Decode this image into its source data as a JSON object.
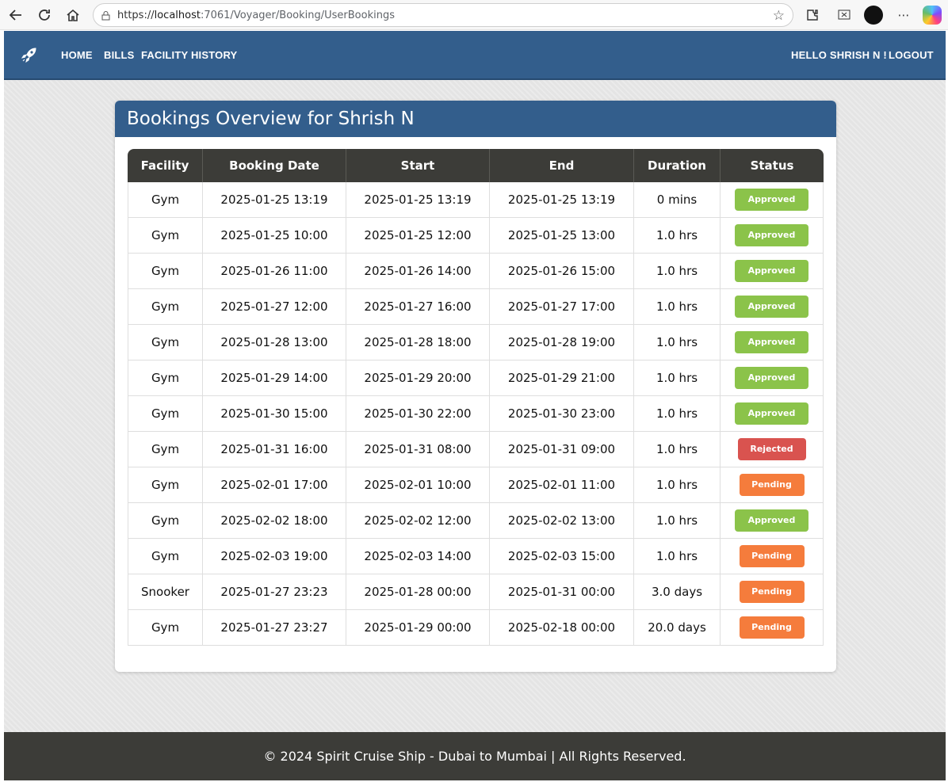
{
  "browser": {
    "url_prefix": "https://",
    "url_host": "localhost",
    "url_rest": ":7061/Voyager/Booking/UserBookings"
  },
  "navbar": {
    "links": [
      "HOME",
      "BILLS",
      "FACILITY HISTORY"
    ],
    "greeting": "HELLO SHRISH N !",
    "logout": "LOGOUT"
  },
  "card": {
    "title": "Bookings Overview for Shrish N"
  },
  "table": {
    "headers": [
      "Facility",
      "Booking Date",
      "Start",
      "End",
      "Duration",
      "Status"
    ],
    "rows": [
      [
        "Gym",
        "2025-01-25 13:19",
        "2025-01-25 13:19",
        "2025-01-25 13:19",
        "0 mins",
        "Approved"
      ],
      [
        "Gym",
        "2025-01-25 10:00",
        "2025-01-25 12:00",
        "2025-01-25 13:00",
        "1.0 hrs",
        "Approved"
      ],
      [
        "Gym",
        "2025-01-26 11:00",
        "2025-01-26 14:00",
        "2025-01-26 15:00",
        "1.0 hrs",
        "Approved"
      ],
      [
        "Gym",
        "2025-01-27 12:00",
        "2025-01-27 16:00",
        "2025-01-27 17:00",
        "1.0 hrs",
        "Approved"
      ],
      [
        "Gym",
        "2025-01-28 13:00",
        "2025-01-28 18:00",
        "2025-01-28 19:00",
        "1.0 hrs",
        "Approved"
      ],
      [
        "Gym",
        "2025-01-29 14:00",
        "2025-01-29 20:00",
        "2025-01-29 21:00",
        "1.0 hrs",
        "Approved"
      ],
      [
        "Gym",
        "2025-01-30 15:00",
        "2025-01-30 22:00",
        "2025-01-30 23:00",
        "1.0 hrs",
        "Approved"
      ],
      [
        "Gym",
        "2025-01-31 16:00",
        "2025-01-31 08:00",
        "2025-01-31 09:00",
        "1.0 hrs",
        "Rejected"
      ],
      [
        "Gym",
        "2025-02-01 17:00",
        "2025-02-01 10:00",
        "2025-02-01 11:00",
        "1.0 hrs",
        "Pending"
      ],
      [
        "Gym",
        "2025-02-02 18:00",
        "2025-02-02 12:00",
        "2025-02-02 13:00",
        "1.0 hrs",
        "Approved"
      ],
      [
        "Gym",
        "2025-02-03 19:00",
        "2025-02-03 14:00",
        "2025-02-03 15:00",
        "1.0 hrs",
        "Pending"
      ],
      [
        "Snooker",
        "2025-01-27 23:23",
        "2025-01-28 00:00",
        "2025-01-31 00:00",
        "3.0 days",
        "Pending"
      ],
      [
        "Gym",
        "2025-01-27 23:27",
        "2025-01-29 00:00",
        "2025-02-18 00:00",
        "20.0 days",
        "Pending"
      ]
    ]
  },
  "status_colors": {
    "Approved": "#8bc34a",
    "Rejected": "#d9534f",
    "Pending": "#f57c3c"
  },
  "footer": {
    "text": "© 2024 Spirit Cruise Ship - Dubai to Mumbai | All Rights Reserved."
  }
}
